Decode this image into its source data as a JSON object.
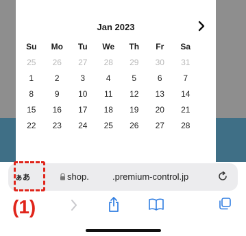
{
  "calendar": {
    "month": "Jan 2023",
    "weekdays": [
      "Su",
      "Mo",
      "Tu",
      "We",
      "Th",
      "Fr",
      "Sa"
    ],
    "weeks": [
      [
        "25",
        "26",
        "27",
        "28",
        "29",
        "30",
        "31"
      ],
      [
        "1",
        "2",
        "3",
        "4",
        "5",
        "6",
        "7"
      ],
      [
        "8",
        "9",
        "10",
        "11",
        "12",
        "13",
        "14"
      ],
      [
        "15",
        "16",
        "17",
        "18",
        "19",
        "20",
        "21"
      ],
      [
        "22",
        "23",
        "24",
        "25",
        "26",
        "27",
        "28"
      ]
    ],
    "muted_rows": [
      0
    ]
  },
  "address_bar": {
    "text_size_label": "ぁあ",
    "url_part1": "shop.",
    "url_part2": ".premium-control.jp"
  },
  "annotation": {
    "label": "(1)",
    "color": "#e0251b"
  },
  "toolbar": {
    "icons": [
      "back-icon",
      "forward-icon",
      "share-icon",
      "bookmarks-icon",
      "tabs-icon"
    ]
  }
}
